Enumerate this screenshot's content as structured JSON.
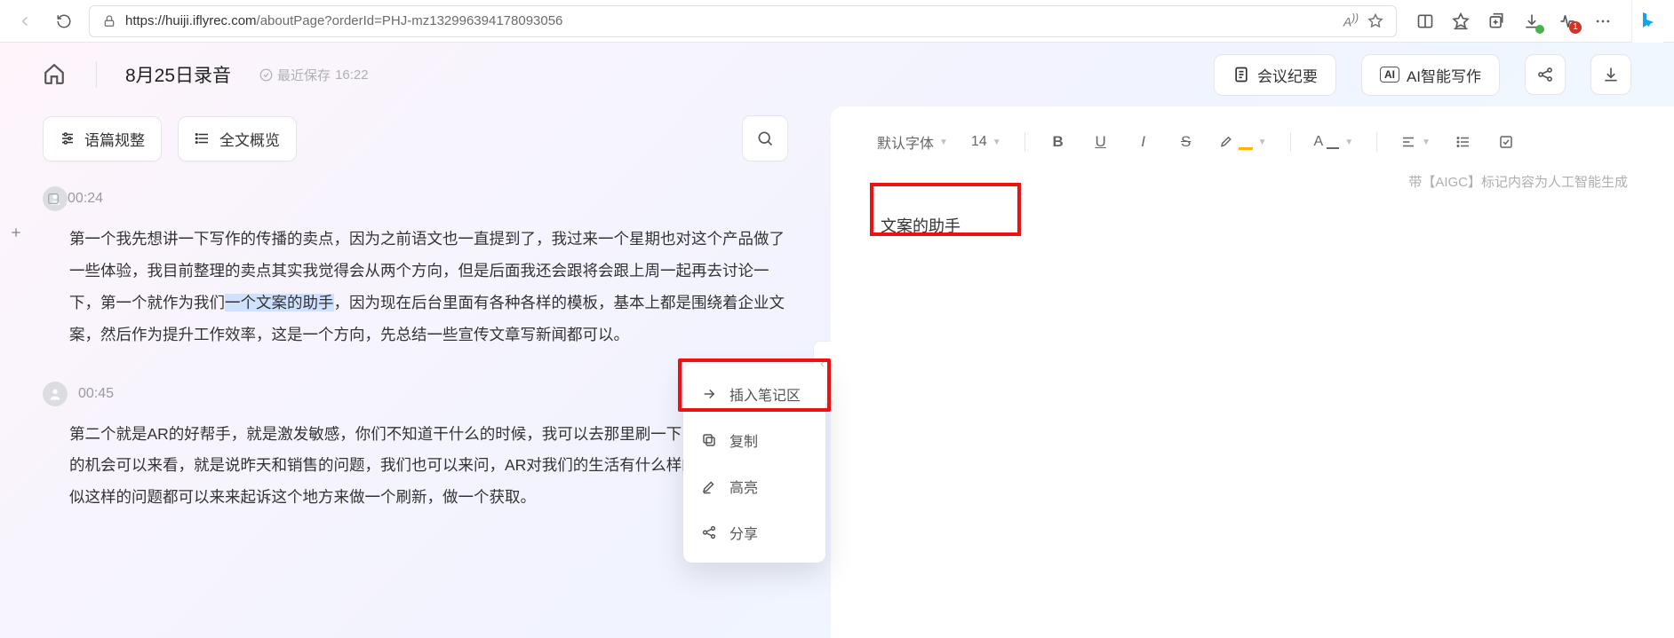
{
  "browser": {
    "url_host": "https://huiji.iflyrec.com",
    "url_path": "/aboutPage?orderId=PHJ-mz132996394178093056",
    "badge": "1"
  },
  "header": {
    "title": "8月25日录音",
    "saved_prefix": "最近保存",
    "saved_time": "16:22",
    "meeting_btn": "会议纪要",
    "ai_btn": "AI智能写作"
  },
  "left_tools": {
    "outline": "语篇规整",
    "overview": "全文概览"
  },
  "transcript": [
    {
      "time": "00:24",
      "pre": "第一个我先想讲一下写作的传播的卖点，因为之前语文也一直提到了，我过来一个星期也对这个产品做了一些体验，我目前整理的卖点其实我觉得会从两个方向，但是后面我还会跟将会跟上周一起再去讨论一下，第一个就作为我们",
      "hl": "一个文案的助手",
      "post": "，因为现在后台里面有各种各样的模板，基本上都是围绕着企业文案，然后作为提升工作效率，这是一个方向，先总结一些宣传文章写新闻都可以。"
    },
    {
      "time": "00:45",
      "pre": "第二个就是AR的好帮手，就是激发敏感，你们不知道干什么的时候，我可以去那里刷一下，总要有更好的机会可以来看，就是说昨天和销售的问题，我们也可以来问，AR对我们的生活有什么样的影响，就类似这样的问题都可以来来起诉这个地方来做一个刷新，做一个获取。",
      "hl": "",
      "post": ""
    }
  ],
  "ctx": {
    "insert": "插入笔记区",
    "copy": "复制",
    "highlight": "高亮",
    "share": "分享"
  },
  "right": {
    "font": "默认字体",
    "size": "14",
    "aigc_note": "带【AIGC】标记内容为人工智能生成",
    "content": "文案的助手"
  }
}
